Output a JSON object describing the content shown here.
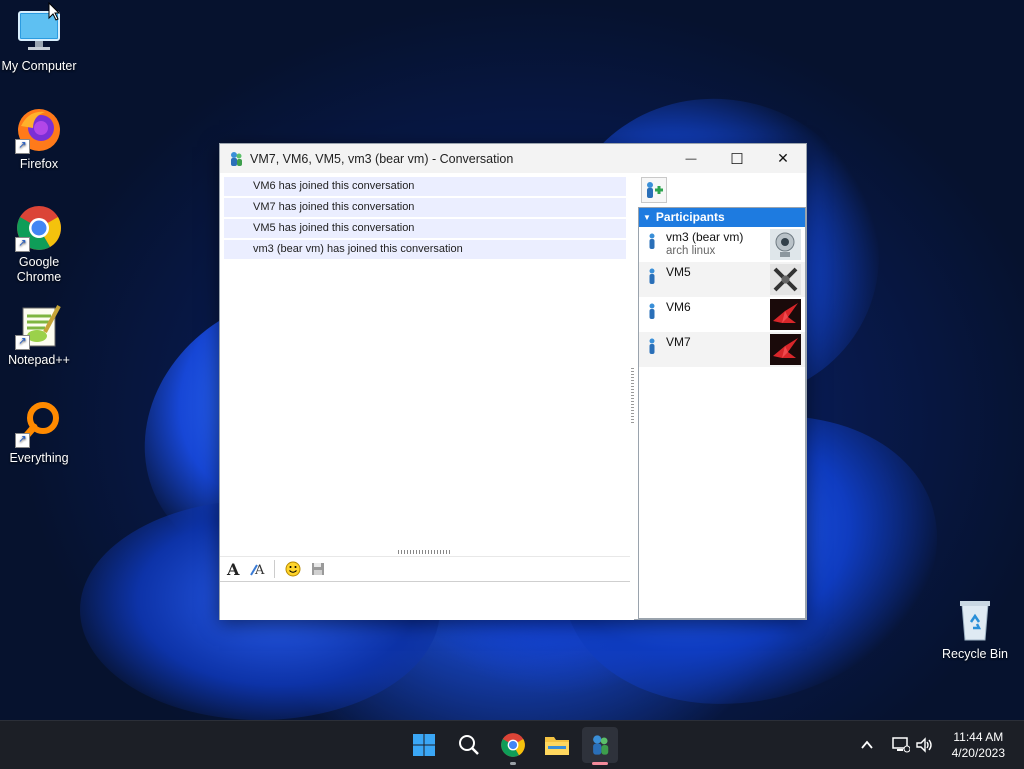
{
  "desktop": {
    "icons": [
      {
        "label": "My Computer",
        "icon": "monitor-icon"
      },
      {
        "label": "Firefox",
        "icon": "firefox-icon"
      },
      {
        "label": "Google Chrome",
        "icon": "chrome-icon"
      },
      {
        "label": "Notepad++",
        "icon": "notepadpp-icon"
      },
      {
        "label": "Everything",
        "icon": "everything-icon"
      },
      {
        "label": "Recycle Bin",
        "icon": "recycle-bin-icon"
      }
    ]
  },
  "window": {
    "title": "VM7, VM6, VM5, vm3 (bear vm) - Conversation",
    "minimize": "—",
    "maximize": "☐",
    "close": "✕"
  },
  "conversation": {
    "messages": [
      "VM6 has joined this conversation",
      "VM7 has joined this conversation",
      "VM5 has joined this conversation",
      "vm3 (bear vm) has joined this conversation"
    ],
    "input_value": ""
  },
  "participants": {
    "header": "Participants",
    "list": [
      {
        "name": "vm3 (bear vm)",
        "status": "arch linux",
        "avatar": "webcam-avatar"
      },
      {
        "name": "VM5",
        "status": "",
        "avatar": "tools-avatar"
      },
      {
        "name": "VM6",
        "status": "",
        "avatar": "origami-crane-avatar"
      },
      {
        "name": "VM7",
        "status": "",
        "avatar": "origami-crane-avatar"
      }
    ]
  },
  "taskbar": {
    "clock_time": "11:44 AM",
    "clock_date": "4/20/2023"
  },
  "colors": {
    "accent": "#1e7be0",
    "message_bg": "#ebeeff",
    "taskbar_bg": "#1c1f26"
  }
}
